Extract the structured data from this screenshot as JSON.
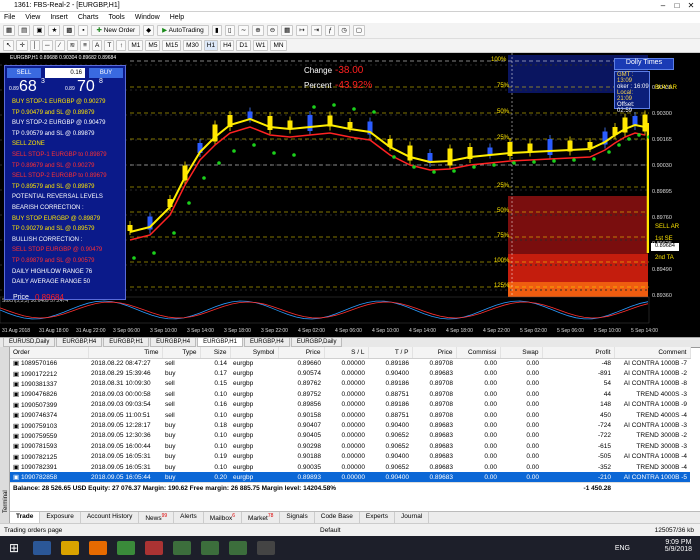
{
  "window": {
    "title": "1361: FBS-Real-2 - [EURGBP,H1]"
  },
  "menu": [
    "File",
    "View",
    "Insert",
    "Charts",
    "Tools",
    "Window",
    "Help"
  ],
  "toolbar": {
    "new_order": "New Order",
    "autotrading": "AutoTrading",
    "timeframes": [
      "M1",
      "M5",
      "M15",
      "M30",
      "H1",
      "H4",
      "D1",
      "W1",
      "MN"
    ]
  },
  "chart": {
    "title": "EURGBP,H1 0.89688 0.90304 0.89682 0.89684",
    "change_label": "Change",
    "change_value": "-38.00",
    "percent_label": "Percent",
    "percent_value": "-43.92%",
    "dolly": {
      "title": "Dolly Times",
      "gmt": "GMT : 13:09",
      "broker": "oker : 16:09",
      "local": "Local: 21:09",
      "offset": "Offset: 02:59"
    },
    "price_labels": [
      "0.90570",
      "0.90435",
      "0.90300",
      "0.90165",
      "0.90030",
      "0.89895",
      "0.89760",
      "0.89625",
      "0.89490",
      "0.89360"
    ],
    "current_price": "0.89684",
    "fib_labels_left": [
      "100%",
      "75%",
      "50%",
      "25%",
      "25%",
      "50%",
      "75%",
      "100%",
      "125%"
    ],
    "right_labels": [
      "BUY AR",
      "SELL AR",
      "1st SE",
      "2nd TA"
    ],
    "stoch_label": "Stoch(5,3,3) 30.6469 57.2474",
    "time_labels": [
      "31 Aug 2018",
      "31 Aug 18:00",
      "31 Aug 22:00",
      "3 Sep 06:00",
      "3 Sep 10:00",
      "3 Sep 14:00",
      "3 Sep 18:00",
      "3 Sep 22:00",
      "4 Sep 02:00",
      "4 Sep 06:00",
      "4 Sep 10:00",
      "4 Sep 14:00",
      "4 Sep 18:00",
      "4 Sep 22:00",
      "5 Sep 02:00",
      "5 Sep 06:00",
      "5 Sep 10:00",
      "5 Sep 14:00"
    ]
  },
  "panel": {
    "sell": "SELL",
    "buy": "BUY",
    "lot": "0.16",
    "bid_big": "68",
    "bid_small": "3",
    "ask_big": "70",
    "ask_small": "8",
    "bid_prefix": "0.89",
    "ask_prefix": "0.89",
    "lines": [
      {
        "t": "BUY STOP-1  EURGBP @ 0.90279",
        "c": "yel"
      },
      {
        "t": "TP 0.90479  and SL @ 0.89879",
        "c": "yel"
      },
      {
        "t": "BUY STOP-2  EURGBP @ 0.90479",
        "c": "wht"
      },
      {
        "t": "TP 0.90579  and SL @ 0.89879",
        "c": "wht"
      },
      {
        "t": "SELL ZONE",
        "c": "yel"
      },
      {
        "t": "SELL STOP-1  EURGBP to 0.89879",
        "c": "red"
      },
      {
        "t": "TP 0.89679  and SL @ 0.90279",
        "c": "red"
      },
      {
        "t": "SELL STOP-2  EURGBP to 0.89679",
        "c": "red"
      },
      {
        "t": "TP 0.89579  and SL @ 0.89879",
        "c": "yel"
      },
      {
        "t": "POTENTIAL REVERSAL LEVELS",
        "c": "wht"
      },
      {
        "t": "BEARISH CORRECTION :",
        "c": "wht"
      },
      {
        "t": "BUY STOP EURGBP @ 0.89879",
        "c": "yel"
      },
      {
        "t": "TP 0.90279  and SL @ 0.89579",
        "c": "yel"
      },
      {
        "t": "BULLISH CORRECTION :",
        "c": "wht"
      },
      {
        "t": "SELL STOP EURGBP @ 0.90479",
        "c": "red"
      },
      {
        "t": "TP 0.89879  and SL @ 0.90579",
        "c": "red"
      },
      {
        "t": "DAILY HIGH/LOW RANGE  76",
        "c": "wht"
      },
      {
        "t": "DAILY AVERAGE RANGE  50",
        "c": "wht"
      }
    ],
    "price_label": "Price",
    "price_value": "0.89684"
  },
  "symbol_tabs": [
    {
      "l": "EURUSD,Daily"
    },
    {
      "l": "EURGBP,H4"
    },
    {
      "l": "EURGBP,H1"
    },
    {
      "l": "EURGBP,H4"
    },
    {
      "l": "EURGBP,H1",
      "on": true
    },
    {
      "l": "EURGBP,H4"
    },
    {
      "l": "EURGBP,Daily"
    }
  ],
  "orders": {
    "columns": [
      "Order",
      "Time",
      "Type",
      "Size",
      "Symbol",
      "Price",
      "S / L",
      "T / P",
      "Price",
      "Commissi",
      "Swap",
      "Profit",
      "Comment"
    ],
    "rows": [
      [
        "1089570166",
        "2018.08.22 08:47:27",
        "sell",
        "0.14",
        "eurgbp",
        "0.89660",
        "0.00000",
        "0.89186",
        "0.89708",
        "0.00",
        "0.00",
        "-48",
        "AI CONTRA 1000B -7"
      ],
      [
        "1090172212",
        "2018.08.29 15:39:46",
        "buy",
        "0.17",
        "eurgbp",
        "0.90574",
        "0.00000",
        "0.90400",
        "0.89683",
        "0.00",
        "0.00",
        "-891",
        "AI CONTRA 1000B -2"
      ],
      [
        "1090381337",
        "2018.08.31 10:09:30",
        "sell",
        "0.15",
        "eurgbp",
        "0.89762",
        "0.00000",
        "0.89186",
        "0.89708",
        "0.00",
        "0.00",
        "54",
        "AI CONTRA 1000B -8"
      ],
      [
        "1090476826",
        "2018.09.03 00:00:58",
        "sell",
        "0.10",
        "eurgbp",
        "0.89752",
        "0.00000",
        "0.88751",
        "0.89708",
        "0.00",
        "0.00",
        "44",
        "TREND 4000S -3"
      ],
      [
        "1090507399",
        "2018.09.03 09:03:54",
        "sell",
        "0.16",
        "eurgbp",
        "0.89856",
        "0.00000",
        "0.89186",
        "0.89708",
        "0.00",
        "0.00",
        "148",
        "AI CONTRA 1000B -9"
      ],
      [
        "1090746374",
        "2018.09.05 11:00:51",
        "sell",
        "0.10",
        "eurgbp",
        "0.90158",
        "0.00000",
        "0.88751",
        "0.89708",
        "0.00",
        "0.00",
        "450",
        "TREND 4000S -4"
      ],
      [
        "1090759103",
        "2018.09.05 12:28:17",
        "buy",
        "0.18",
        "eurgbp",
        "0.90407",
        "0.00000",
        "0.90400",
        "0.89683",
        "0.00",
        "0.00",
        "-724",
        "AI CONTRA 1000B -3"
      ],
      [
        "1090759559",
        "2018.09.05 12:30:36",
        "buy",
        "0.10",
        "eurgbp",
        "0.90405",
        "0.00000",
        "0.90652",
        "0.89683",
        "0.00",
        "0.00",
        "-722",
        "TREND 3000B -2"
      ],
      [
        "1090781593",
        "2018.09.05 16:00:44",
        "buy",
        "0.10",
        "eurgbp",
        "0.90298",
        "0.00000",
        "0.90652",
        "0.89683",
        "0.00",
        "0.00",
        "-615",
        "TREND 3000B -3"
      ],
      [
        "1090782125",
        "2018.09.05 16:05:31",
        "buy",
        "0.19",
        "eurgbp",
        "0.90188",
        "0.00000",
        "0.90400",
        "0.89683",
        "0.00",
        "0.00",
        "-505",
        "AI CONTRA 1000B -4"
      ],
      [
        "1090782391",
        "2018.09.05 16:05:31",
        "buy",
        "0.10",
        "eurgbp",
        "0.90035",
        "0.00000",
        "0.90652",
        "0.89683",
        "0.00",
        "0.00",
        "-352",
        "TREND 3000B -4"
      ],
      [
        "1090782858",
        "2018.09.05 16:05:44",
        "buy",
        "0.20",
        "eurgbp",
        "0.89893",
        "0.00000",
        "0.90400",
        "0.89683",
        "0.00",
        "0.00",
        "-210",
        "AI CONTRA 1000B -5"
      ]
    ],
    "selected_index": 11,
    "balance": "Balance: 28 526.65 USD  Equity: 27 076.37  Margin: 190.62  Free margin: 26 885.75  Margin level: 14204.58%",
    "total_profit": "-1 450.28"
  },
  "terminal_label": "Terminal",
  "bottom_tabs": [
    {
      "l": "Trade",
      "on": true
    },
    {
      "l": "Exposure"
    },
    {
      "l": "Account History"
    },
    {
      "l": "News",
      "n": "99"
    },
    {
      "l": "Alerts"
    },
    {
      "l": "Mailbox",
      "n": "6"
    },
    {
      "l": "Market",
      "n": "78"
    },
    {
      "l": "Signals"
    },
    {
      "l": "Code Base"
    },
    {
      "l": "Experts"
    },
    {
      "l": "Journal"
    }
  ],
  "status": {
    "left": "Trading orders page",
    "middle": "Default",
    "right": "125057/36 kb"
  },
  "taskbar": {
    "time": "9:09 PM",
    "date": "5/9/2018",
    "lang": "ENG"
  }
}
